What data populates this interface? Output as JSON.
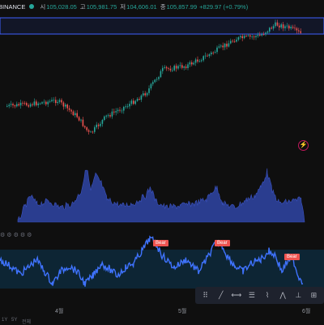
{
  "header": {
    "symbol_text": "BINANCE",
    "open_label": "시",
    "open_value": "105,028.05",
    "high_label": "고",
    "high_value": "105,981.75",
    "low_label": "저",
    "low_value": "104,606.01",
    "close_label": "종",
    "close_value": "105,857.99",
    "change": "+829.97 (+0.79%)"
  },
  "colors": {
    "up": "#26a69a",
    "down": "#ef5350",
    "volume": "#2a3d8f",
    "rsi_line": "#3f73ff",
    "band": "#0e2a3a",
    "highlight": "#2962ff"
  },
  "indicator_badges": [
    "Bear",
    "Bear",
    "Bear"
  ],
  "indicator_settings": [
    "⚙",
    "⚙",
    "⚙",
    "⚙",
    "⚙"
  ],
  "x_axis": {
    "apr": "4월",
    "may": "5월",
    "jun": "6월"
  },
  "bottom_bar": {
    "item1": "1Y",
    "item2": "5Y",
    "item3": "전체"
  },
  "toolbar_icons": [
    "grid-dots-icon",
    "trend-line-icon",
    "horizontal-line-icon",
    "fib-icon",
    "brush-icon",
    "pattern-icon",
    "ruler-icon",
    "text-icon"
  ]
}
